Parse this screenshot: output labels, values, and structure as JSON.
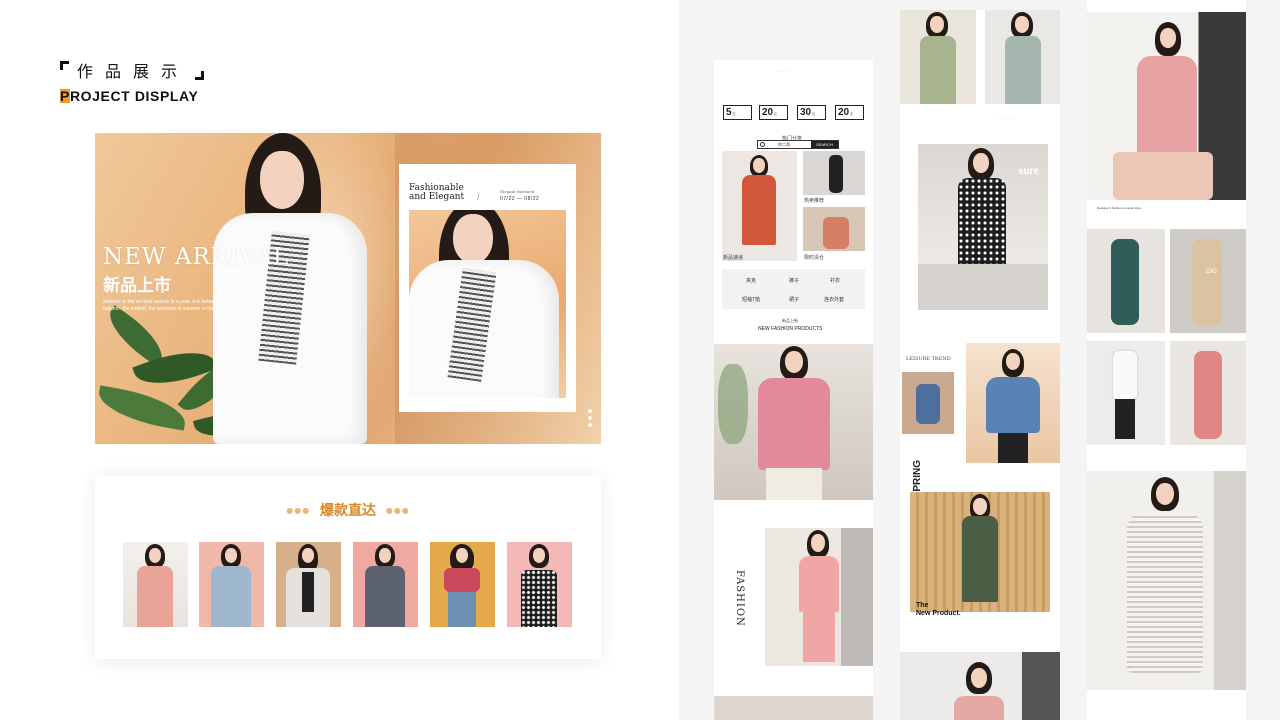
{
  "header": {
    "cn_title": "作品展示",
    "en_title": "PROJECT DISPLAY"
  },
  "banner": {
    "title": "NEW ARRIVAL",
    "cn_title": "新品上市",
    "subtitle": "summer is the second season in a year, it is between spring and autumn. the hottest, the warmest of summer is the warmest",
    "frame_heading_1": "Fashionable",
    "frame_heading_2": "and Elegant",
    "frame_small": "Elegant fastened",
    "frame_date": "07/22 — 08/22"
  },
  "hot": {
    "title": "爆款直达",
    "items": [
      "item-1",
      "item-2",
      "item-3",
      "item-4",
      "item-5",
      "item-6"
    ]
  },
  "mobile_page": {
    "search_value": "你二哥",
    "search_button": "SEARCH",
    "coupons": [
      "5",
      "20",
      "30",
      "20"
    ],
    "section_title": "热门分类",
    "tiles": [
      "新品速递",
      "热卖推荐",
      "限时清仓"
    ],
    "categories": [
      "夹克",
      "裤子",
      "衬衣",
      "短袖T恤",
      "裙子",
      "连衣外套"
    ],
    "new_cn": "新品上新",
    "new_en": "NEW FASHION PRODUCTS",
    "fashion_vertical": "FASHION"
  },
  "column_two": {
    "leisure": "LEISURE TREND",
    "spring": "SPRING",
    "the_new": "The",
    "new_product": "New Product."
  },
  "column_three": {
    "caption": "Designer's fashion romantic style"
  },
  "colors": {
    "accent": "#f39a2b",
    "hot_title": "#d88a2a",
    "panel": "#f4f4f4"
  }
}
